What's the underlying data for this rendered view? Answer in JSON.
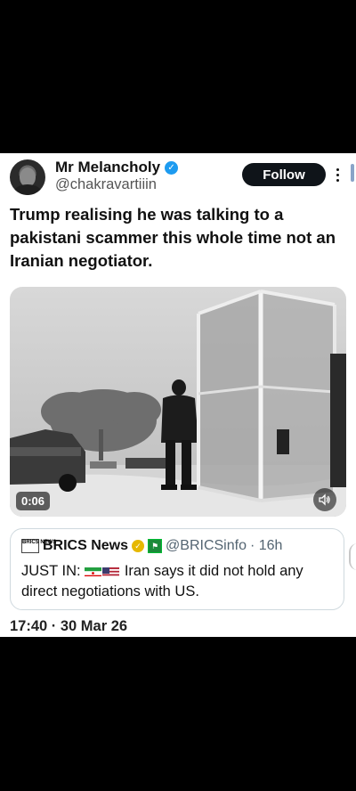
{
  "author": {
    "name": "Mr Melancholy",
    "handle": "@chakravartiiin",
    "verified_icon": "verified-badge-icon"
  },
  "follow_label": "Follow",
  "tweet_text": "Trump realising he was talking to a pakistani scammer this whole time not an Iranian negotiator.",
  "video": {
    "duration": "0:06",
    "sound_icon": "volume-icon"
  },
  "quote": {
    "logo_text": "BRICS NEWS",
    "name": "BRICS News",
    "handle": "@BRICSinfo",
    "time": "· 16h",
    "text_prefix": "JUST IN:",
    "text_body": "Iran says it did not hold any direct negotiations with US."
  },
  "timestamp": "17:40 · 30 Mar 26",
  "colors": {
    "accent_blue": "#1d9bf0",
    "follow_bg": "#0f1419",
    "gold_badge": "#e6b800"
  }
}
